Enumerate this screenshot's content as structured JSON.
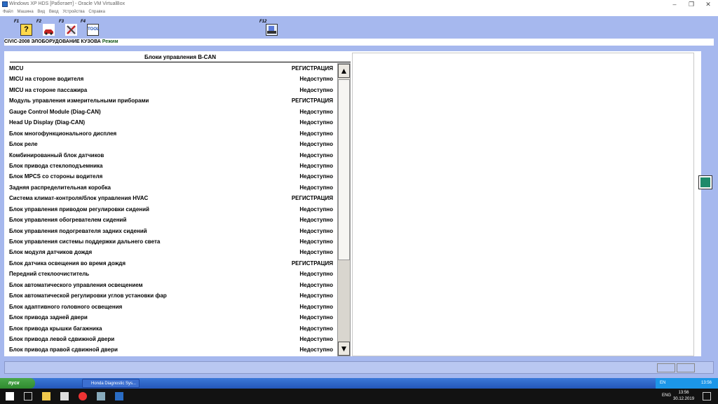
{
  "host": {
    "title": "Windows XP HDS [Работает] - Oracle VM VirtualBox",
    "menu": [
      "Файл",
      "Машина",
      "Вид",
      "Ввод",
      "Устройства",
      "Справка"
    ]
  },
  "toolbar": {
    "f1": "F1",
    "f2": "F2",
    "f3": "F3",
    "f4": "F4",
    "f12": "F12",
    "f1_icon": "?",
    "f4_icon": "TOOL"
  },
  "breadcrumb": {
    "path": "CIVIC-2008  ЭЛОБОРУДОВАНИЕ КУЗОВА",
    "mode": "Режим"
  },
  "list": {
    "header": "Блоки управления B-CAN",
    "rows": [
      {
        "name": "MICU",
        "status": "РЕГИСТРАЦИЯ"
      },
      {
        "name": "MICU на стороне водителя",
        "status": "Недоступно"
      },
      {
        "name": "MICU на стороне пассажира",
        "status": "Недоступно"
      },
      {
        "name": "Модуль управления измерительными приборами",
        "status": "РЕГИСТРАЦИЯ"
      },
      {
        "name": "Gauge Control Module (Diag-CAN)",
        "status": "Недоступно"
      },
      {
        "name": "Head Up Display (Diag-CAN)",
        "status": "Недоступно"
      },
      {
        "name": "Блок многофункционального дисплея",
        "status": "Недоступно"
      },
      {
        "name": "Блок реле",
        "status": "Недоступно"
      },
      {
        "name": "Комбинированный блок датчиков",
        "status": "Недоступно"
      },
      {
        "name": "Блок привода стеклоподъемника",
        "status": "Недоступно"
      },
      {
        "name": "Блок MPCS со стороны водителя",
        "status": "Недоступно"
      },
      {
        "name": "Задняя распределительная коробка",
        "status": "Недоступно"
      },
      {
        "name": "Система климат-контроля/блок управления HVAC",
        "status": "РЕГИСТРАЦИЯ"
      },
      {
        "name": "Блок управления приводом регулировки сидений",
        "status": "Недоступно"
      },
      {
        "name": "Блок управления обогревателем сидений",
        "status": "Недоступно"
      },
      {
        "name": "Блок управления подогревателя задних сидений",
        "status": "Недоступно"
      },
      {
        "name": "Блок управления системы поддержки дальнего света",
        "status": "Недоступно"
      },
      {
        "name": "Блок модуля датчиков дождя",
        "status": "Недоступно"
      },
      {
        "name": "Блок датчика освещения во время дождя",
        "status": "РЕГИСТРАЦИЯ"
      },
      {
        "name": "Передний стеклоочиститель",
        "status": "Недоступно"
      },
      {
        "name": "Блок автоматического управления освещением",
        "status": "Недоступно"
      },
      {
        "name": "Блок автоматической регулировки углов установки фар",
        "status": "Недоступно"
      },
      {
        "name": "Блок адаптивного головного освещения",
        "status": "Недоступно"
      },
      {
        "name": "Блок привода задней двери",
        "status": "Недоступно"
      },
      {
        "name": "Блок привода крышки багажника",
        "status": "Недоступно"
      },
      {
        "name": "Блок привода левой сдвижной двери",
        "status": "Недоступно"
      },
      {
        "name": "Блок привода правой сдвижной двери",
        "status": "Недоступно"
      }
    ],
    "scroll_up": "▲",
    "scroll_down": "▼"
  },
  "xp": {
    "start": "пуск",
    "task": "Honda Diagnostic Sys...",
    "tray_lang": "EN",
    "tray_time": "13:56"
  },
  "win": {
    "lang": "ENG",
    "time": "13:56",
    "date": "30.12.2019"
  },
  "colors": {
    "vm_bg": "#a6b8ee",
    "mode": "#1a5a1a",
    "xp_bar": "#2456b8"
  }
}
